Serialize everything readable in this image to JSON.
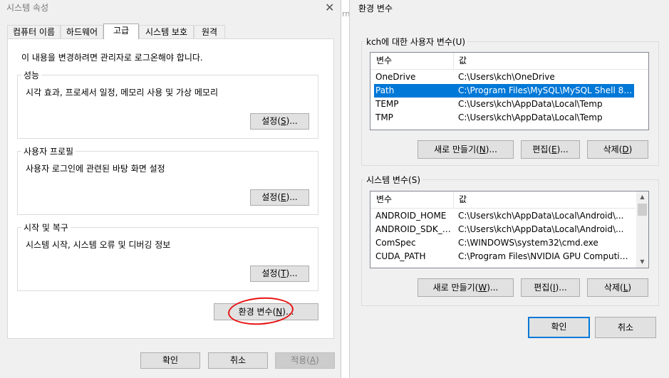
{
  "system_properties": {
    "title": "시스템 속성",
    "tabs": [
      "컴퓨터 이름",
      "하드웨어",
      "고급",
      "시스템 보호",
      "원격"
    ],
    "admin_notice": "이 내용을 변경하려면 관리자로 로그온해야 합니다.",
    "performance": {
      "legend": "성능",
      "description": "시각 효과, 프로세서 일정, 메모리 사용 및 가상 메모리",
      "button_pre": "설정(",
      "button_key": "S",
      "button_post": ")..."
    },
    "user_profiles": {
      "legend": "사용자 프로필",
      "description": "사용자 로그인에 관련된 바탕 화면 설정",
      "button_pre": "설정(",
      "button_key": "E",
      "button_post": ")..."
    },
    "startup_recovery": {
      "legend": "시작 및 복구",
      "description": "시스템 시작, 시스템 오류 및 디버깅 정보",
      "button_pre": "설정(",
      "button_key": "T",
      "button_post": ")..."
    },
    "env_button": {
      "pre": "환경 변수(",
      "key": "N",
      "post": ")..."
    },
    "ok": "확인",
    "cancel": "취소",
    "apply_pre": "적용(",
    "apply_key": "A",
    "apply_post": ")"
  },
  "background_peek": "rn",
  "env_vars": {
    "title": "환경 변수",
    "user_section": {
      "legend": "kch에 대한 사용자 변수(U)",
      "col_var": "변수",
      "col_val": "값",
      "rows": [
        {
          "name": "OneDrive",
          "value": "C:\\Users\\kch\\OneDrive",
          "selected": false
        },
        {
          "name": "Path",
          "value": "C:\\Program Files\\MySQL\\MySQL Shell 8....",
          "selected": true
        },
        {
          "name": "TEMP",
          "value": "C:\\Users\\kch\\AppData\\Local\\Temp",
          "selected": false
        },
        {
          "name": "TMP",
          "value": "C:\\Users\\kch\\AppData\\Local\\Temp",
          "selected": false
        }
      ],
      "new_pre": "새로 만들기(",
      "new_key": "N",
      "new_post": ")...",
      "edit_pre": "편집(",
      "edit_key": "E",
      "edit_post": ")...",
      "delete_pre": "삭제(",
      "delete_key": "D",
      "delete_post": ")"
    },
    "system_section": {
      "legend": "시스템 변수(S)",
      "col_var": "변수",
      "col_val": "값",
      "rows": [
        {
          "name": "ANDROID_HOME",
          "value": "C:\\Users\\kch\\AppData\\Local\\Android\\..."
        },
        {
          "name": "ANDROID_SDK_R...",
          "value": "C:\\Users\\kch\\AppData\\Local\\Android\\..."
        },
        {
          "name": "ComSpec",
          "value": "C:\\WINDOWS\\system32\\cmd.exe"
        },
        {
          "name": "CUDA_PATH",
          "value": "C:\\Program Files\\NVIDIA GPU Computing..."
        }
      ],
      "new_pre": "새로 만들기(",
      "new_key": "W",
      "new_post": ")...",
      "edit_pre": "편집(",
      "edit_key": "I",
      "edit_post": ")...",
      "delete_pre": "삭제(",
      "delete_key": "L",
      "delete_post": ")"
    },
    "ok": "확인",
    "cancel": "취소"
  },
  "colors": {
    "selection": "#0078d7",
    "annotation": "#e81313",
    "dialog_bg": "#f0f0f0"
  }
}
